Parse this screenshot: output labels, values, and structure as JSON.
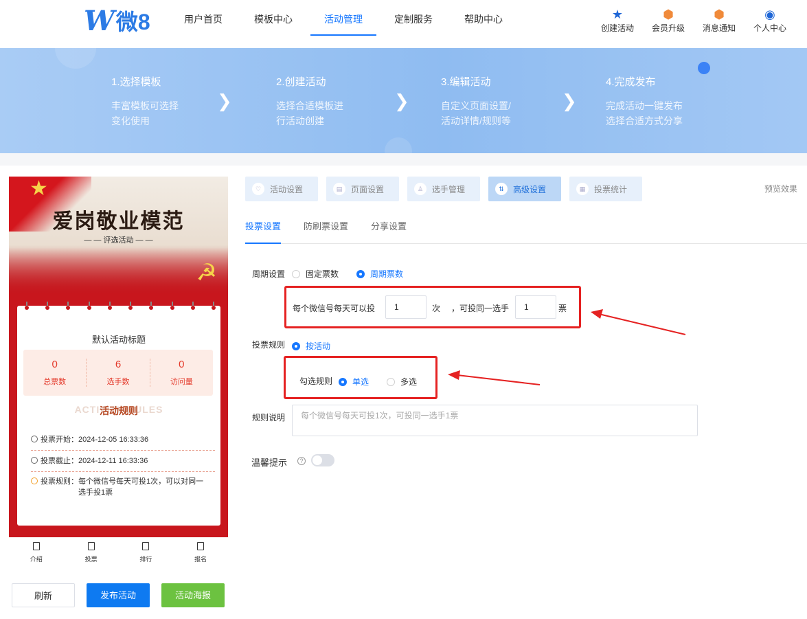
{
  "header": {
    "logo_text": "微8",
    "nav": [
      {
        "label": "用户首页"
      },
      {
        "label": "模板中心"
      },
      {
        "label": "活动管理"
      },
      {
        "label": "定制服务"
      },
      {
        "label": "帮助中心"
      }
    ],
    "active_nav": 2,
    "icons": [
      {
        "label": "创建活动",
        "icon": "star-icon"
      },
      {
        "label": "会员升级",
        "icon": "crown-badge-icon"
      },
      {
        "label": "消息通知",
        "icon": "bell-badge-icon"
      },
      {
        "label": "个人中心",
        "icon": "user-icon"
      }
    ]
  },
  "banner": {
    "steps": [
      {
        "title": "1.选择模板",
        "desc1": "丰富模板可选择",
        "desc2": "变化使用"
      },
      {
        "title": "2.创建活动",
        "desc1": "选择合适模板进",
        "desc2": "行活动创建"
      },
      {
        "title": "3.编辑活动",
        "desc1": "自定义页面设置/",
        "desc2": "活动详情/规则等"
      },
      {
        "title": "4.完成发布",
        "desc1": "完成活动一键发布",
        "desc2": "选择合适方式分享"
      }
    ]
  },
  "phone": {
    "poster_title": "爱岗敬业模范",
    "poster_sub": "— — 评选活动 — —",
    "card_title": "默认活动标题",
    "stats": [
      {
        "value": "0",
        "label": "总票数"
      },
      {
        "value": "6",
        "label": "选手数"
      },
      {
        "value": "0",
        "label": "访问量"
      }
    ],
    "rule_bg": "ACTIVITY RULES",
    "rule_title": "活动规则",
    "start": "投票开始：2024-12-05 16:33:36",
    "end": "投票截止：2024-12-11 16:33:36",
    "rule1": "投票规则：每个微信号每天可投1次，可以对同一",
    "rule2": "选手投1票",
    "tabbar": [
      {
        "label": "介绍"
      },
      {
        "label": "投票"
      },
      {
        "label": "排行"
      },
      {
        "label": "报名"
      }
    ]
  },
  "buttons": {
    "refresh": "刷新",
    "publish": "发布活动",
    "poster": "活动海报"
  },
  "tabs": [
    {
      "label": "活动设置",
      "icon": "heart-icon"
    },
    {
      "label": "页面设置",
      "icon": "page-icon"
    },
    {
      "label": "选手管理",
      "icon": "person-icon"
    },
    {
      "label": "高级设置",
      "icon": "sliders-icon"
    },
    {
      "label": "投票统计",
      "icon": "chart-icon"
    }
  ],
  "active_tab": 3,
  "preview": "预览效果",
  "subtabs": [
    {
      "label": "投票设置"
    },
    {
      "label": "防刷票设置"
    },
    {
      "label": "分享设置"
    }
  ],
  "form": {
    "period_label": "周期设置",
    "period_opt1": "固定票数",
    "period_opt2": "周期票数",
    "per_day_text": "每个微信号每天可以投",
    "per_day_value": "1",
    "times_unit": "次",
    "same_text": "，可投同一选手",
    "same_value": "1",
    "votes_unit": "票",
    "rule_label": "投票规则",
    "rule_opt": "按活动",
    "check_label": "勾选规则",
    "check_opt1": "单选",
    "check_opt2": "多选",
    "desc_label": "规则说明",
    "desc_placeholder": "每个微信号每天可投1次，可投同一选手1票",
    "tip_label": "温馨提示"
  },
  "colors": {
    "primary": "#1677ff",
    "annotation": "#e52222",
    "banner": "#9ec6f4"
  }
}
